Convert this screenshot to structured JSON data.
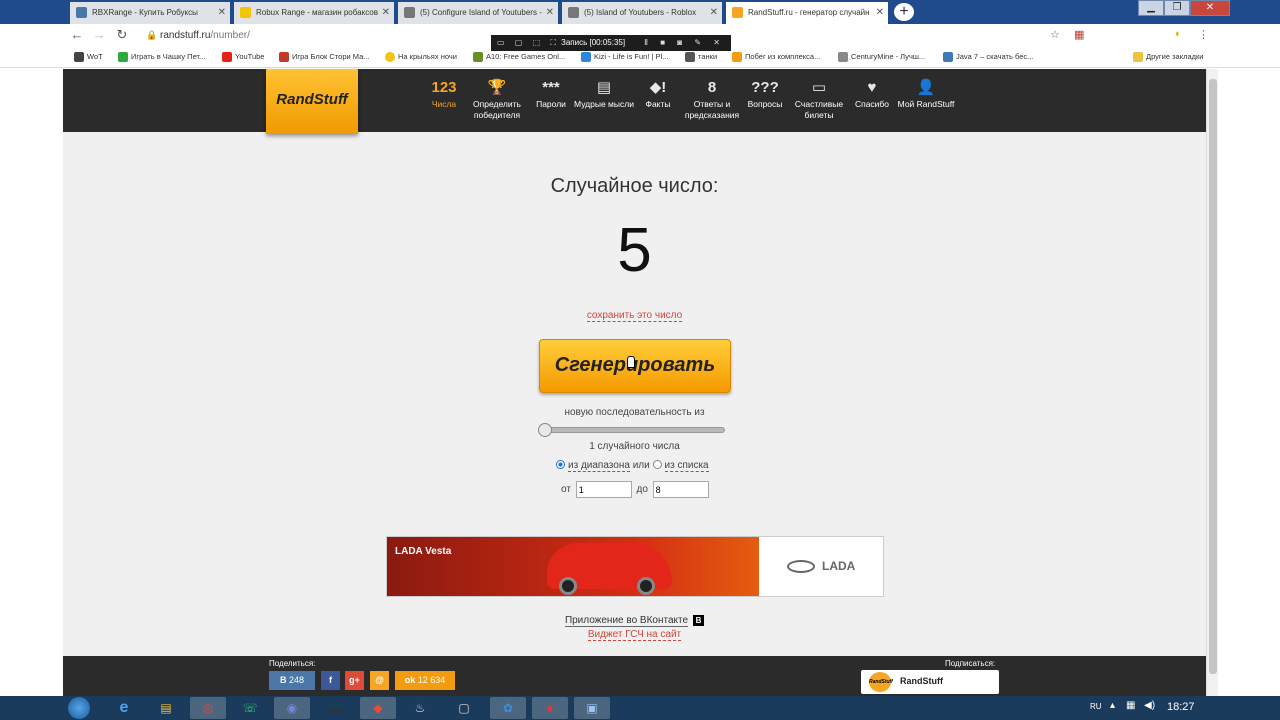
{
  "browser": {
    "tabs": [
      {
        "label": "RBXRange - Купить Робуксы",
        "color": "#4a76a8"
      },
      {
        "label": "Robux Range - магазин робаксов",
        "color": "#f5c400"
      },
      {
        "label": "(5) Configure Island of Youtubers -",
        "color": "#777777"
      },
      {
        "label": "(5) Island of Youtubers - Roblox",
        "color": "#777777"
      },
      {
        "label": "RandStuff.ru - генератор случайн",
        "color": "#f5a623"
      }
    ],
    "new_tab": "+",
    "url_host": "randstuff.ru",
    "url_path": "/number/",
    "recorder": {
      "label": "Запись [00:05:35]",
      "icons": "▭ ▢ ⬚ ⛶",
      "tools": "Ⅱ ■ ◙ ✎ ✕"
    },
    "toolbar_right": [
      "☆",
      "▦",
      "◐",
      "⋮"
    ],
    "bookmarks": [
      {
        "label": "WoT",
        "color": "#444444"
      },
      {
        "label": "Играть в Чашку Пет...",
        "color": "#2eaa3c"
      },
      {
        "label": "YouTube",
        "color": "#e62117"
      },
      {
        "label": "Игра Блок Стори Ма...",
        "color": "#c0392b"
      },
      {
        "label": "На крыльях ночи",
        "color": "#f1c40f"
      },
      {
        "label": "A10: Free Games Onl...",
        "color": "#6b8e23"
      },
      {
        "label": "Kizi - Life is Fun! | Pl...",
        "color": "#2e86de"
      },
      {
        "label": "танки",
        "color": "#555555"
      },
      {
        "label": "Побег из комплекса...",
        "color": "#f39c12"
      },
      {
        "label": "CenturyMine - Лучш...",
        "color": "#888888"
      },
      {
        "label": "Java 7 – скачать бес...",
        "color": "#3d7ab8"
      },
      {
        "label": "Другие закладки",
        "color": "#f0c040"
      }
    ]
  },
  "site": {
    "logo": "RandStuff",
    "nav": [
      {
        "icon": "123",
        "label": "Числа",
        "active": true
      },
      {
        "icon": "🏆",
        "label": "Определить победителя",
        "active": false
      },
      {
        "icon": "***",
        "label": "Пароли",
        "active": false
      },
      {
        "icon": "▤",
        "label": "Мудрые мысли",
        "active": false
      },
      {
        "icon": "◆!",
        "label": "Факты",
        "active": false
      },
      {
        "icon": "8",
        "label": "Ответы и предсказания",
        "active": false
      },
      {
        "icon": "???",
        "label": "Вопросы",
        "active": false
      },
      {
        "icon": "▭",
        "label": "Счастливые билеты",
        "active": false
      },
      {
        "icon": "♥",
        "label": "Спасибо",
        "active": false
      },
      {
        "icon": "👤",
        "label": "Мой RandStuff",
        "active": false
      }
    ],
    "title": "Случайное число:",
    "number": "5",
    "save_link": "сохранить это число",
    "generate_button": "Сгенерировать",
    "sequence_label": "новую последовательность из",
    "sequence_count": 1,
    "count_label": "1 случайного числа",
    "range_option": "из диапазона",
    "or_text": "или",
    "list_option": "из списка",
    "from_label": "от",
    "from_value": "1",
    "to_label": "до",
    "to_value": "8",
    "ad": {
      "title": "LADA Vesta",
      "brand": "LADA"
    },
    "vk_app": "Приложение во ВКонтакте",
    "vk_badge": "В",
    "widget_link": "Виджет ГСЧ на сайт",
    "share_label": "Поделиться:",
    "share_buttons": [
      {
        "icon": "В",
        "count": "248",
        "color": "#4a76a8"
      },
      {
        "icon": "f",
        "count": "",
        "color": "#3b5998"
      },
      {
        "icon": "g+",
        "count": "",
        "color": "#dd4b39"
      },
      {
        "icon": "@",
        "count": "",
        "color": "#f5a623"
      },
      {
        "icon": "ok",
        "count": "12 634",
        "color": "#f39c12"
      }
    ],
    "subscribe_label": "Подписаться:",
    "subscribe_name": "RandStuff",
    "mini_logo": "RandStuff"
  },
  "taskbar": {
    "apps": [
      "e",
      "▤",
      "◎",
      "☏",
      "◉",
      "▬",
      "◆",
      "♨",
      "▢",
      "✿",
      "●",
      "▣"
    ],
    "language": "RU",
    "time": "18:27"
  },
  "colors": {
    "accent": "#f5a623",
    "link_red": "#d0453a",
    "header_dark": "#2b2b2b"
  }
}
